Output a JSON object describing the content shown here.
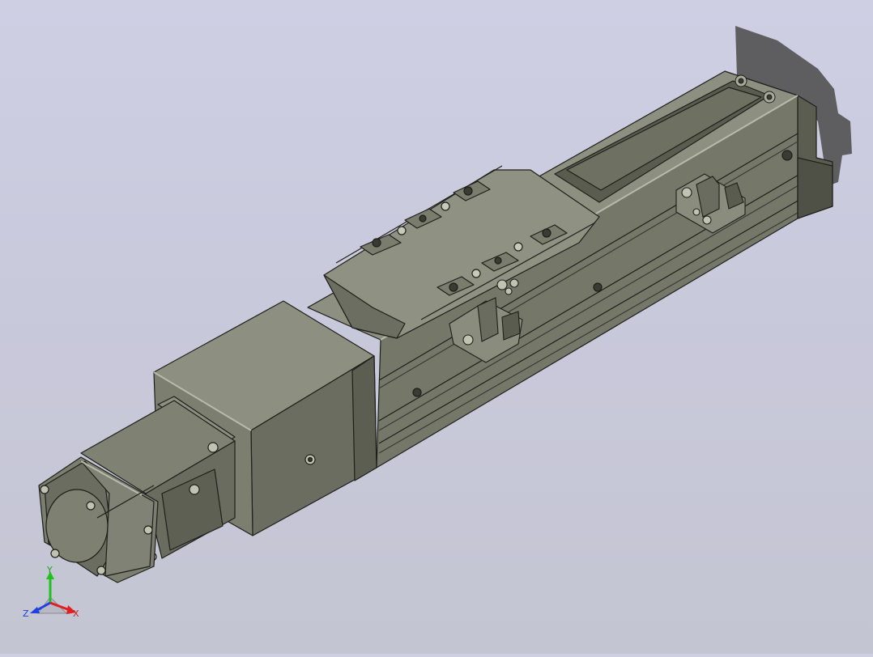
{
  "viewport": {
    "background_top": "#cfcfe4",
    "background_bottom": "#c4c5d2",
    "model_color": "#6f7163",
    "edge_color": "#1e1f1a"
  },
  "triad": {
    "x_label": "X",
    "y_label": "Y",
    "z_label": "Z",
    "x_color": "#e02020",
    "y_color": "#20c020",
    "z_color": "#2040e0"
  }
}
